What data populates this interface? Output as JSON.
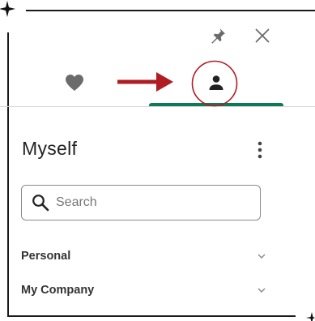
{
  "panel": {
    "title": "Myself"
  },
  "search": {
    "placeholder": "Search",
    "value": ""
  },
  "sections": [
    {
      "label": "Personal"
    },
    {
      "label": "My Company"
    }
  ],
  "colors": {
    "tab_active_underline": "#0d7a55",
    "annotation_red": "#b01c24",
    "icon_gray": "#6b6b6b"
  },
  "icons": {
    "pin": "pin-icon",
    "close": "close-icon",
    "favorites_tab": "heart-icon",
    "profile_tab": "person-icon",
    "more": "kebab-menu-icon",
    "search": "search-icon",
    "expand": "chevron-down-icon"
  }
}
